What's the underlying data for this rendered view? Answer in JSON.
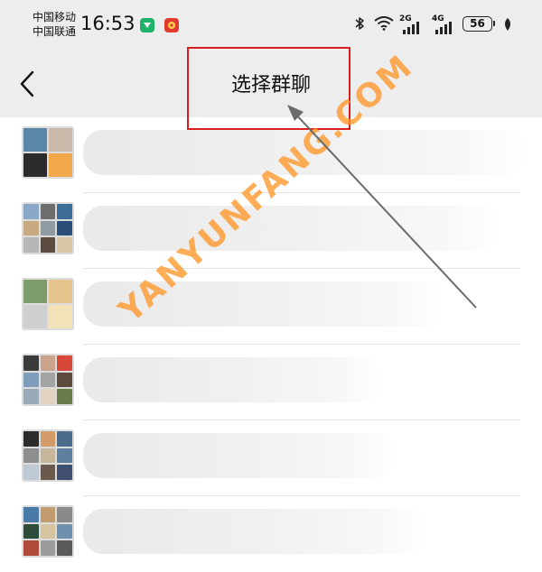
{
  "status_bar": {
    "carrier_1": "中国移动",
    "carrier_2": "中国联通",
    "time": "16:53",
    "network_1": "2G",
    "network_2": "4G",
    "battery": "56"
  },
  "nav": {
    "title": "选择群聊",
    "back_icon": "chevron-left-icon"
  },
  "groups": [
    {
      "avatar_layout": "2x2",
      "tiles": [
        "#5a86a8",
        "#c9b9a8",
        "#2b2b2b",
        "#f2a84a"
      ]
    },
    {
      "avatar_layout": "3x3",
      "tiles": [
        "#8aa7c7",
        "#6d6d6d",
        "#3c6d99",
        "#c7a982",
        "#8f9aa3",
        "#2a4e7a",
        "#b7b7b7",
        "#5b4c3f",
        "#d8c6a7"
      ]
    },
    {
      "avatar_layout": "2x2",
      "tiles": [
        "#7c9c6a",
        "#e7c48d",
        "#cfcfcf",
        "#f3e2b8"
      ]
    },
    {
      "avatar_layout": "3x3",
      "tiles": [
        "#3b3b3b",
        "#c9a48a",
        "#d8473a",
        "#7f9cbb",
        "#a3a3a3",
        "#5c4a3c",
        "#9aaab8",
        "#e1d3be",
        "#6b7a4a"
      ]
    },
    {
      "avatar_layout": "3x3",
      "tiles": [
        "#2c2c2c",
        "#d39b6a",
        "#4b6c8f",
        "#8e8e8e",
        "#c6b79a",
        "#5f7f9e",
        "#bfc9d3",
        "#6a5a4e",
        "#3f4f6f"
      ]
    },
    {
      "avatar_layout": "3x3",
      "tiles": [
        "#4a7aa6",
        "#c29b6e",
        "#8a8a8a",
        "#2f4b3a",
        "#d6c3a0",
        "#6f8fb0",
        "#b04a3a",
        "#9c9c9c",
        "#5a5a5a"
      ]
    }
  ],
  "watermark": "YANYUNFANG.COM",
  "colors": {
    "highlight": "#d81e1e",
    "watermark": "#ff9628",
    "header_bg": "#ededed"
  }
}
